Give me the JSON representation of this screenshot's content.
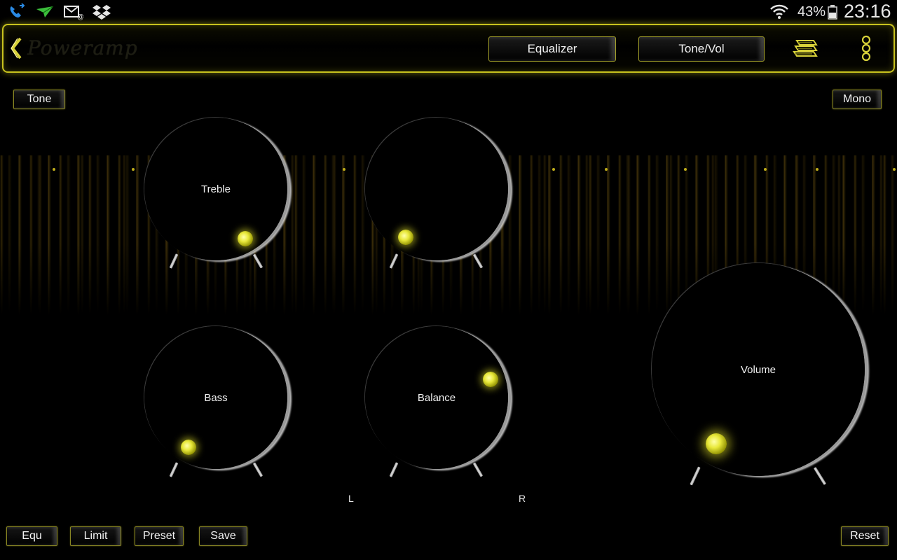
{
  "status_bar": {
    "icons": [
      "phone-wifi-icon",
      "airplane-send-icon",
      "email-icon",
      "dropbox-icon",
      "wifi-icon",
      "battery-icon"
    ],
    "battery_percent": "43%",
    "clock": "23:16"
  },
  "header": {
    "app_name": "Poweramp",
    "equalizer_label": "Equalizer",
    "tonevol_label": "Tone/Vol",
    "colors": {
      "accent": "#c8c21e"
    }
  },
  "controls": {
    "tone_label": "Tone",
    "mono_label": "Mono"
  },
  "knobs": {
    "treble": {
      "label": "Treble"
    },
    "unlabeled": {
      "label": ""
    },
    "bass": {
      "label": "Bass"
    },
    "balance": {
      "label": "Balance",
      "left_label": "L",
      "right_label": "R"
    },
    "volume": {
      "label": "Volume"
    }
  },
  "footer": {
    "equ_label": "Equ",
    "limit_label": "Limit",
    "preset_label": "Preset",
    "save_label": "Save",
    "reset_label": "Reset"
  }
}
